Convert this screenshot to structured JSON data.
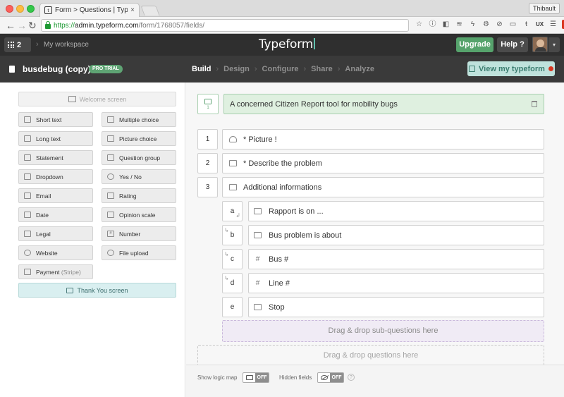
{
  "browser": {
    "tab_title": "Form > Questions | Typeform",
    "tab_favicon_letter": "t",
    "tab_close": "×",
    "profile_name": "Thibault",
    "url_scheme": "https://",
    "url_host": "admin.typeform.com",
    "url_path": "/form/1768057/fields/",
    "back_glyph": "←",
    "forward_glyph": "→",
    "reload_glyph": "↻",
    "extension_icons": [
      "star-icon",
      "info-icon",
      "extension-icon",
      "layers-icon",
      "bolt-icon",
      "gear-icon",
      "block-icon",
      "cast-icon",
      "t-icon",
      "ux-icon",
      "menu-icon",
      "rust-icon",
      "bell-icon"
    ]
  },
  "header": {
    "workspace_count": "2",
    "workspace_name": "My workspace",
    "logo": "Typeform",
    "upgrade_label": "Upgrade",
    "help_label": "Help ?",
    "caret": "▾"
  },
  "formbar": {
    "form_name": "busdebug (copy)",
    "badge": "PRO TRIAL",
    "steps": [
      "Build",
      "Design",
      "Configure",
      "Share",
      "Analyze"
    ],
    "active_step": "Build",
    "view_button": "View my typeform"
  },
  "sidebar": {
    "welcome_label": "Welcome screen",
    "question_types": [
      {
        "label": "Short text",
        "icon": "short-text-icon"
      },
      {
        "label": "Multiple choice",
        "icon": "multiple-choice-icon"
      },
      {
        "label": "Long text",
        "icon": "long-text-icon"
      },
      {
        "label": "Picture choice",
        "icon": "picture-choice-icon"
      },
      {
        "label": "Statement",
        "icon": "statement-icon"
      },
      {
        "label": "Question group",
        "icon": "question-group-icon"
      },
      {
        "label": "Dropdown",
        "icon": "dropdown-icon"
      },
      {
        "label": "Yes / No",
        "icon": "yes-no-icon"
      },
      {
        "label": "Email",
        "icon": "email-icon"
      },
      {
        "label": "Rating",
        "icon": "rating-icon"
      },
      {
        "label": "Date",
        "icon": "date-icon"
      },
      {
        "label": "Opinion scale",
        "icon": "opinion-scale-icon"
      },
      {
        "label": "Legal",
        "icon": "legal-icon"
      },
      {
        "label": "Number",
        "icon": "number-icon"
      },
      {
        "label": "Website",
        "icon": "website-icon"
      },
      {
        "label": "File upload",
        "icon": "file-upload-icon"
      }
    ],
    "payment_label": "Payment",
    "payment_sub": "(Stripe)",
    "thankyou_label": "Thank You screen"
  },
  "builder": {
    "welcome_number": "1",
    "welcome_text": "A concerned Citizen Report tool for mobility bugs",
    "questions": [
      {
        "number": "1",
        "text": "* Picture !",
        "icon": "cloud-upload-icon"
      },
      {
        "number": "2",
        "text": "* Describe the problem",
        "icon": "short-text-icon"
      },
      {
        "number": "3",
        "text": "Additional informations",
        "icon": "question-group-icon"
      }
    ],
    "sub_questions": [
      {
        "letter": "a",
        "text": "Rapport is on ...",
        "icon": "picture-choice-icon"
      },
      {
        "letter": "b",
        "text": "Bus problem is about",
        "icon": "multiple-choice-icon"
      },
      {
        "letter": "c",
        "text": "Bus #",
        "icon": "number-icon"
      },
      {
        "letter": "d",
        "text": "Line #",
        "icon": "number-icon"
      },
      {
        "letter": "e",
        "text": "Stop",
        "icon": "short-text-icon"
      }
    ],
    "drop_sub_label": "Drag & drop sub-questions here",
    "drop_q_label": "Drag & drop questions here"
  },
  "footer": {
    "logic_map_label": "Show logic map",
    "logic_map_state": "OFF",
    "hidden_fields_label": "Hidden fields",
    "hidden_fields_state": "OFF",
    "help_glyph": "?"
  }
}
